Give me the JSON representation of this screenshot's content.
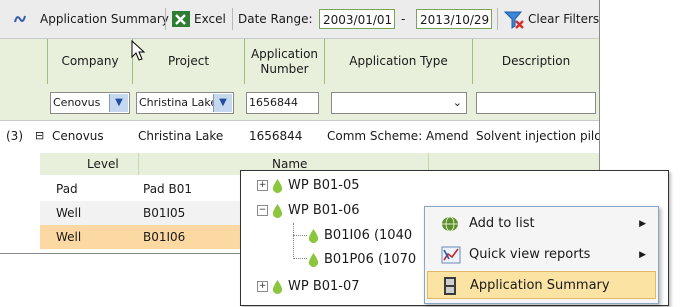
{
  "toolbar": {
    "app_summary_label": "Application Summary",
    "excel_label": "Excel",
    "date_range_label": "Date Range:",
    "date_from": "2003/01/01",
    "date_dash": "-",
    "date_to": "2013/10/29",
    "clear_filters_label": "Clear Filters"
  },
  "columns": [
    "Company",
    "Project",
    "Application Number",
    "Application Type",
    "Description"
  ],
  "filters": {
    "company": "Cenovus",
    "project": "Christina Lake",
    "application_number": "1656844",
    "application_type": "",
    "description": ""
  },
  "row": {
    "count": "(3)",
    "expander": "⊟",
    "company": "Cenovus",
    "project": "Christina Lake",
    "application_number": "1656844",
    "application_type": "Comm Scheme: Amend",
    "description": "Solvent injection pilot"
  },
  "subgrid": {
    "headers": [
      "Level",
      "Name"
    ],
    "rows": [
      {
        "level": "Pad",
        "name": "Pad B01"
      },
      {
        "level": "Well",
        "name": "B01I05"
      },
      {
        "level": "Well",
        "name": "B01I06"
      }
    ]
  },
  "tree": {
    "items": [
      {
        "sign": "+",
        "label": "WP B01-05"
      },
      {
        "sign": "−",
        "label": "WP B01-06"
      },
      {
        "sign": "",
        "label": "B01I06 (1040"
      },
      {
        "sign": "",
        "label": "B01P06 (1070"
      },
      {
        "sign": "+",
        "label": "WP B01-07"
      }
    ]
  },
  "context_menu": {
    "items": [
      {
        "label": "Add to list",
        "has_submenu": true,
        "icon": "globe-icon"
      },
      {
        "label": "Quick view reports",
        "has_submenu": true,
        "icon": "chart-icon"
      },
      {
        "label": "Application Summary",
        "has_submenu": false,
        "icon": "film-icon",
        "highlighted": true
      }
    ]
  },
  "colors": {
    "header_green": "#e8f0dc",
    "selected_row": "#fcd9a3",
    "menu_highlight": "#fbe3a3",
    "leaf_green": "#8cc63f"
  }
}
